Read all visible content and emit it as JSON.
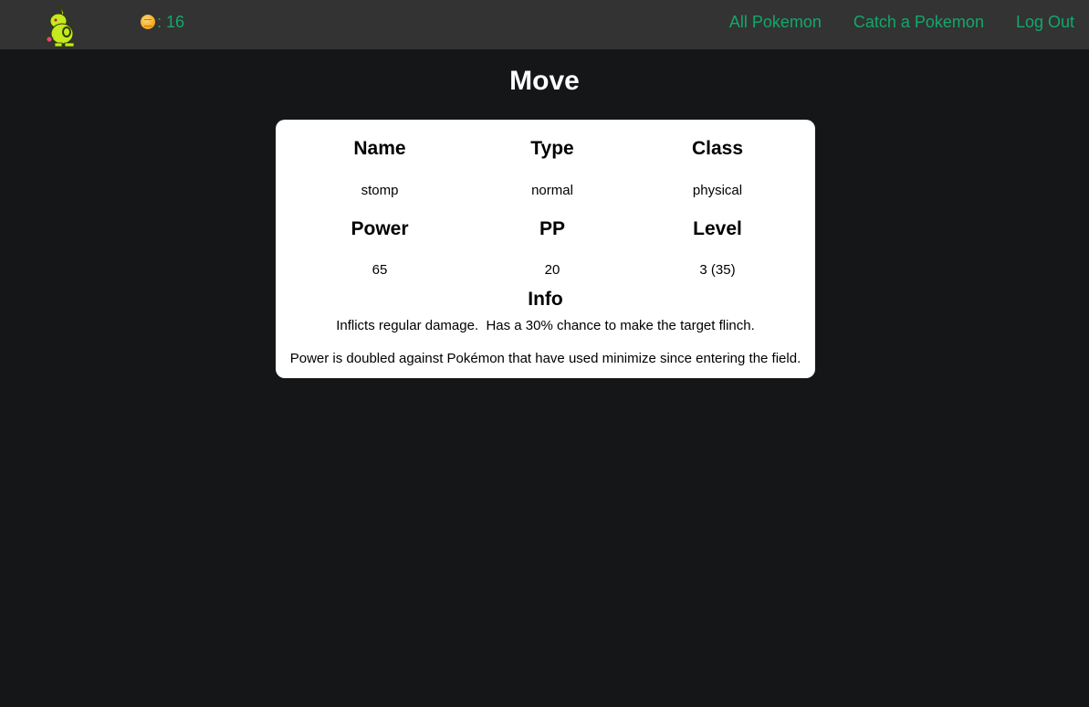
{
  "header": {
    "coin_icon": "coin-icon",
    "coins_text": ": 16",
    "links": {
      "all_pokemon": "All Pokemon",
      "catch_pokemon": "Catch a Pokemon",
      "log_out": "Log Out"
    },
    "link_color": "#12a86b",
    "background_color": "#333333"
  },
  "page": {
    "title": "Move",
    "background_color": "#151618"
  },
  "move": {
    "labels": {
      "name": "Name",
      "type": "Type",
      "class": "Class",
      "power": "Power",
      "pp": "PP",
      "level": "Level",
      "info": "Info"
    },
    "values": {
      "name": "stomp",
      "type": "normal",
      "class": "physical",
      "power": "65",
      "pp": "20",
      "level": "3 (35)"
    },
    "info_lines": [
      "Inflicts regular damage.  Has a 30% chance to make the target flinch.",
      "Power is doubled against Pokémon that have used minimize since entering the field."
    ]
  }
}
